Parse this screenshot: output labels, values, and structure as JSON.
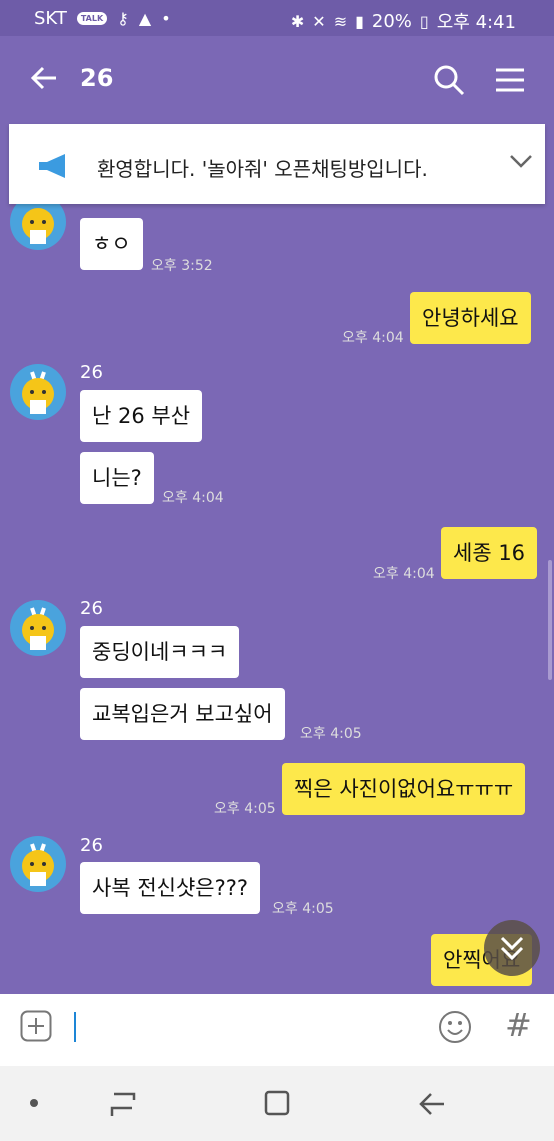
{
  "status_bar": {
    "carrier": "SKT",
    "talk_badge": "TALK",
    "battery": "20%",
    "time": "오후 4:41"
  },
  "header": {
    "title": "26"
  },
  "notice": {
    "text": "환영합니다. '놀아줘' 오픈채팅방입니다."
  },
  "messages": [
    {
      "direction": "in",
      "text": "ㅎㅇ",
      "time": "오후 3:52"
    },
    {
      "direction": "out",
      "text": "안녕하세요",
      "time": "오후 4:04"
    },
    {
      "direction": "in",
      "sender": "26",
      "text": "난 26 부산"
    },
    {
      "direction": "in",
      "text": "니는?",
      "time": "오후 4:04"
    },
    {
      "direction": "out",
      "text": "세종 16",
      "time": "오후 4:04"
    },
    {
      "direction": "in",
      "sender": "26",
      "text": "중딩이네ㅋㅋㅋ"
    },
    {
      "direction": "in",
      "text": "교복입은거 보고싶어",
      "time": "오후 4:05"
    },
    {
      "direction": "out",
      "text": "찍은 사진이없어요ㅠㅠㅠ",
      "time": "오후 4:05"
    },
    {
      "direction": "in",
      "sender": "26",
      "text": "사복 전신샷은???",
      "time": "오후 4:05"
    },
    {
      "direction": "out",
      "text": "안찍어요"
    }
  ],
  "colors": {
    "chat_background": "#7b68b5",
    "outgoing_bubble": "#fde84b",
    "incoming_bubble": "#ffffff"
  },
  "input_bar": {
    "hash_label": "#"
  }
}
